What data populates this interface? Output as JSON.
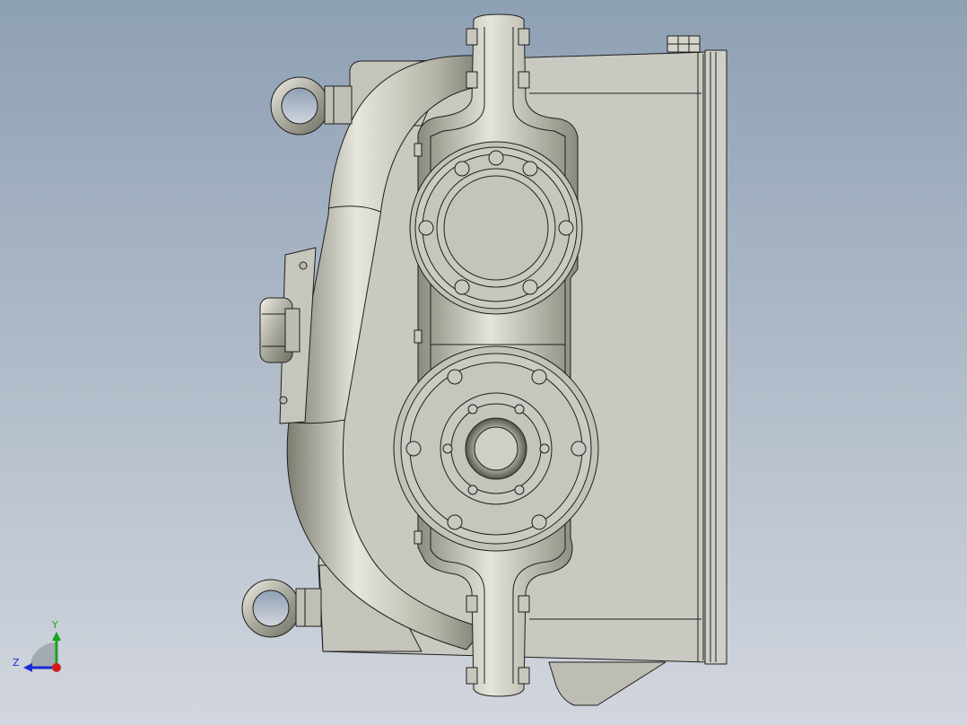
{
  "viewport": {
    "background_top": "#8ea0b4",
    "background_bottom": "#d2d6de"
  },
  "model": {
    "body_color": "#c9c9c1",
    "body_shade": "#b9b9b0",
    "duct_light": "#e6e6dc",
    "duct_mid": "#b4b4a8",
    "duct_dark": "#7c7c70",
    "edge_color": "#1f1f1f"
  },
  "triad": {
    "y_label": "Y",
    "z_label": "Z",
    "y_color": "#1aa31a",
    "z_color": "#1a2ed6",
    "x_color": "#d61a1a"
  }
}
